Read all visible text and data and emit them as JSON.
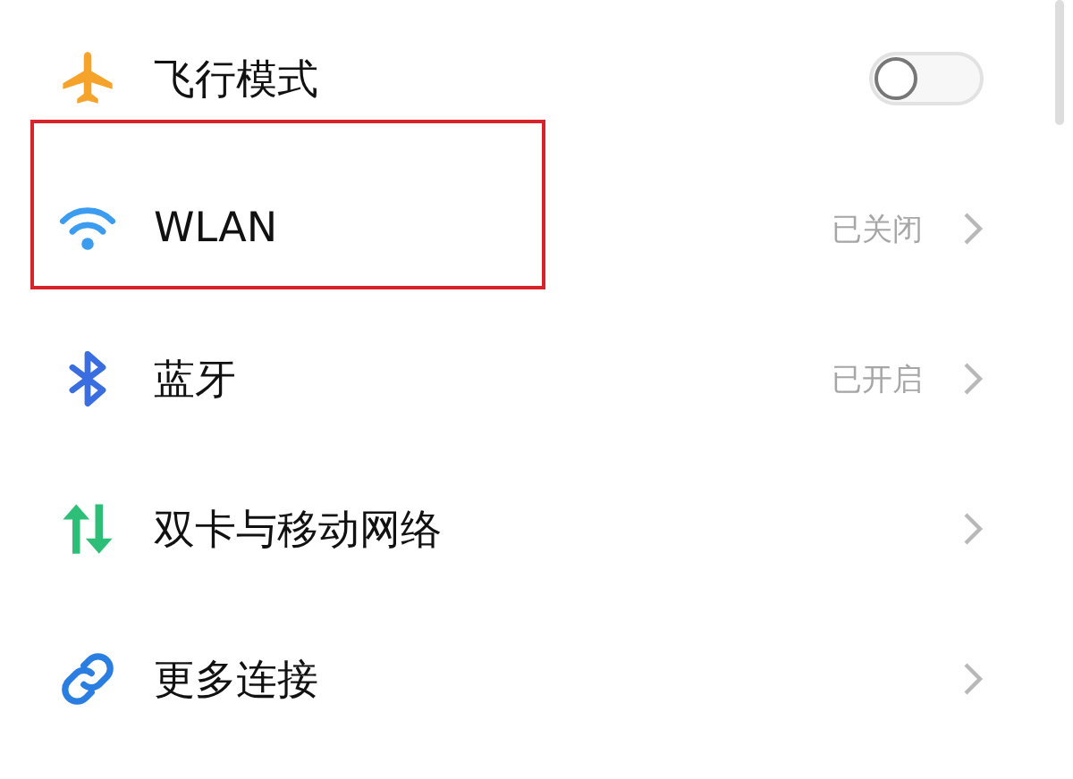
{
  "settings": [
    {
      "kind": "toggle",
      "label": "飞行模式",
      "on": false
    },
    {
      "kind": "link",
      "label": "WLAN",
      "status": "已关闭",
      "highlighted": true
    },
    {
      "kind": "link",
      "label": "蓝牙",
      "status": "已开启"
    },
    {
      "kind": "link",
      "label": "双卡与移动网络"
    },
    {
      "kind": "link",
      "label": "更多连接"
    }
  ]
}
